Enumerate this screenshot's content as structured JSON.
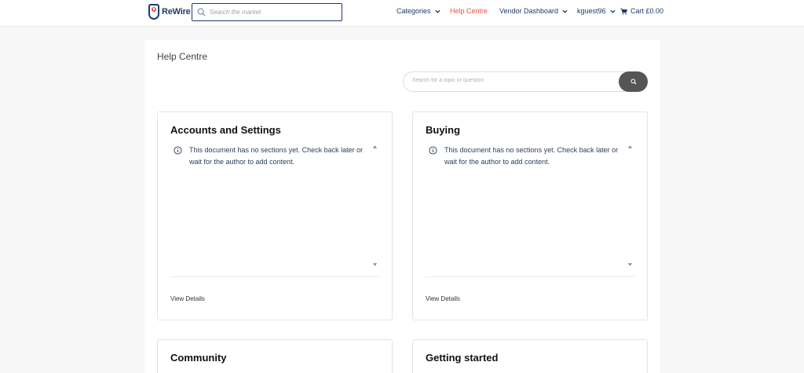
{
  "brand": {
    "name": "ReWire"
  },
  "header": {
    "search_placeholder": "Search the market",
    "nav": {
      "categories": "Categories",
      "help_centre": "Help Centre",
      "vendor_dashboard": "Vendor Dashboard",
      "user": "kguest96",
      "cart": "Cart £0.00"
    }
  },
  "page": {
    "title": "Help Centre",
    "search_placeholder": "Search for a topic or question"
  },
  "topics": [
    {
      "title": "Accounts and Settings",
      "notice": "This document has no sections yet. Check back later or wait for the author to add content.",
      "link": "View Details"
    },
    {
      "title": "Buying",
      "notice": "This document has no sections yet. Check back later or wait for the author to add content.",
      "link": "View Details"
    },
    {
      "title": "Community"
    },
    {
      "title": "Getting started"
    }
  ],
  "colors": {
    "brand_navy": "#1f3b6b",
    "accent": "#e8523f",
    "search_button": "#555555",
    "page_bg": "#f7f7f7"
  },
  "icons": {
    "logo": "rewire-logo-icon",
    "search": "search-icon",
    "caret": "chevron-down-icon",
    "cart": "cart-icon",
    "info": "info-icon"
  }
}
